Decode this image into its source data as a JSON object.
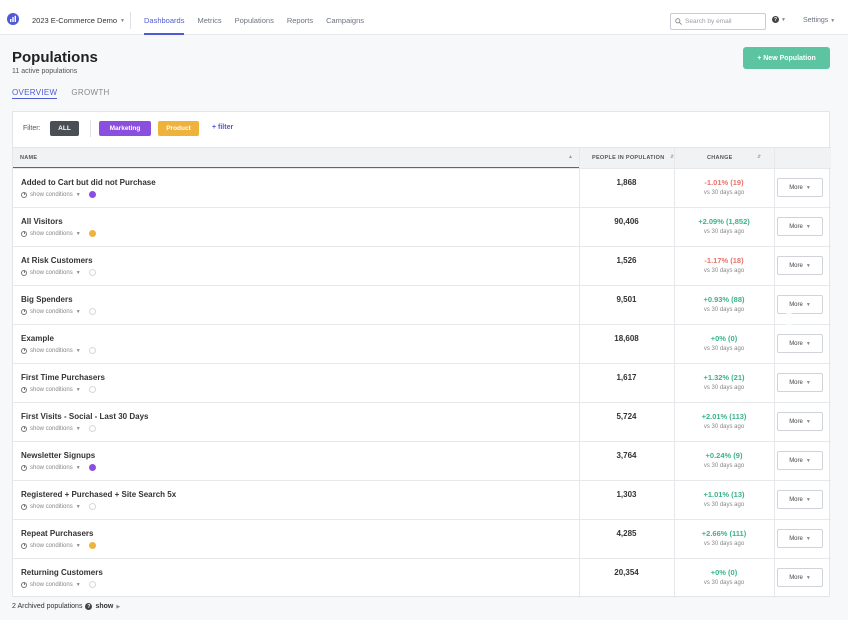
{
  "nav": {
    "logo_icon": "bar-chart-logo-icon",
    "project": "2023 E-Commerce Demo",
    "links": [
      "Dashboards",
      "Metrics",
      "Populations",
      "Reports",
      "Campaigns"
    ],
    "active_link": "Dashboards",
    "search_placeholder": "Search by email",
    "help_icon": "question-icon",
    "settings": "Settings"
  },
  "page": {
    "title": "Populations",
    "subtitle": "11 active populations",
    "tabs": [
      "OVERVIEW",
      "GROWTH"
    ],
    "active_tab": "OVERVIEW",
    "new_button": "+ New Population"
  },
  "filters": {
    "label": "Filter:",
    "all": "ALL",
    "marketing": "Marketing",
    "product": "Product",
    "add": "+ filter",
    "colors": {
      "all": "#4a4f55",
      "marketing": "#8b4fe0",
      "product": "#efb23a"
    }
  },
  "table": {
    "headers": {
      "name": "NAME",
      "people": "PEOPLE IN POPULATION",
      "change": "CHANGE"
    },
    "show_conditions": "show conditions",
    "vs_label": "vs 30 days ago",
    "more_label": "More",
    "colors": {
      "positive": "#3bb38a",
      "negative": "#e5736b",
      "marketing_dot": "#8b4fe0",
      "product_dot": "#efb23a"
    },
    "rows": [
      {
        "name": "Added to Cart but did not Purchase",
        "count": "1,868",
        "change": "-1.01% (19)",
        "trend": "negative",
        "tag": "marketing"
      },
      {
        "name": "All Visitors",
        "count": "90,406",
        "change": "+2.09% (1,852)",
        "trend": "positive",
        "tag": "product"
      },
      {
        "name": "At Risk Customers",
        "count": "1,526",
        "change": "-1.17% (18)",
        "trend": "negative",
        "tag": "none"
      },
      {
        "name": "Big Spenders",
        "count": "9,501",
        "change": "+0.93% (88)",
        "trend": "positive",
        "tag": "none"
      },
      {
        "name": "Example",
        "count": "18,608",
        "change": "+0% (0)",
        "trend": "positive",
        "tag": "none"
      },
      {
        "name": "First Time Purchasers",
        "count": "1,617",
        "change": "+1.32% (21)",
        "trend": "positive",
        "tag": "none"
      },
      {
        "name": "First Visits - Social - Last 30 Days",
        "count": "5,724",
        "change": "+2.01% (113)",
        "trend": "positive",
        "tag": "none"
      },
      {
        "name": "Newsletter Signups",
        "count": "3,764",
        "change": "+0.24% (9)",
        "trend": "positive",
        "tag": "marketing"
      },
      {
        "name": "Registered + Purchased + Site Search 5x",
        "count": "1,303",
        "change": "+1.01% (13)",
        "trend": "positive",
        "tag": "none"
      },
      {
        "name": "Repeat Purchasers",
        "count": "4,285",
        "change": "+2.66% (111)",
        "trend": "positive",
        "tag": "product"
      },
      {
        "name": "Returning Customers",
        "count": "20,354",
        "change": "+0% (0)",
        "trend": "positive",
        "tag": "none"
      }
    ]
  },
  "footer": {
    "archived": "2 Archived populations",
    "show": "show"
  }
}
